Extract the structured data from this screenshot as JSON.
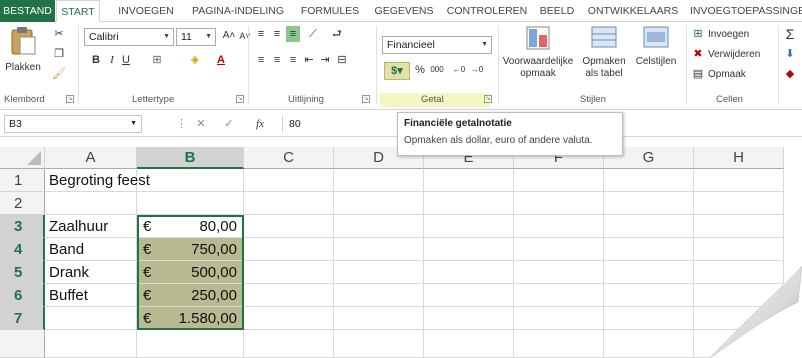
{
  "ribbon_tabs": [
    "BESTAND",
    "START",
    "INVOEGEN",
    "PAGINA-INDELING",
    "FORMULES",
    "GEGEVENS",
    "CONTROLEREN",
    "BEELD",
    "ONTWIKKELAARS",
    "INVOEGTOEPASSINGEN"
  ],
  "clipboard": {
    "paste_label": "Plakken",
    "group_label": "Klembord"
  },
  "font": {
    "name": "Calibri",
    "size": "11",
    "bold": "B",
    "italic": "I",
    "underline": "U",
    "group_label": "Lettertype"
  },
  "alignment": {
    "group_label": "Uitlijning"
  },
  "number": {
    "format": "Financieel",
    "percent": "%",
    "thousands": "000",
    "group_label": "Getal"
  },
  "styles": {
    "conditional": [
      "Voorwaardelijke",
      "opmaak"
    ],
    "table": [
      "Opmaken",
      "als tabel"
    ],
    "cell_styles": "Celstijlen",
    "group_label": "Stijlen"
  },
  "cells_group": {
    "insert": "Invoegen",
    "delete": "Verwijderen",
    "format": "Opmaak",
    "group_label": "Cellen"
  },
  "formula_bar": {
    "name_box": "B3",
    "fx": "fx",
    "value": "80"
  },
  "tooltip": {
    "title": "Financiële getalnotatie",
    "description": "Opmaken als dollar, euro of andere valuta."
  },
  "sheet": {
    "columns": [
      "A",
      "B",
      "C",
      "D",
      "E",
      "F",
      "G",
      "H"
    ],
    "rows": [
      "1",
      "2",
      "3",
      "4",
      "5",
      "6",
      "7"
    ],
    "a1": "Begroting feest",
    "entries": [
      {
        "label": "Zaalhuur",
        "currency": "€",
        "amount": "80,00"
      },
      {
        "label": "Band",
        "currency": "€",
        "amount": "750,00"
      },
      {
        "label": "Drank",
        "currency": "€",
        "amount": "500,00"
      },
      {
        "label": "Buffet",
        "currency": "€",
        "amount": "250,00"
      }
    ],
    "total": {
      "currency": "€",
      "amount": "1.580,00"
    },
    "active_cell": "B3"
  },
  "colors": {
    "accent": "#217346",
    "selection_fill": "#b8ba91",
    "getal_highlight": "#f5f6c2"
  }
}
